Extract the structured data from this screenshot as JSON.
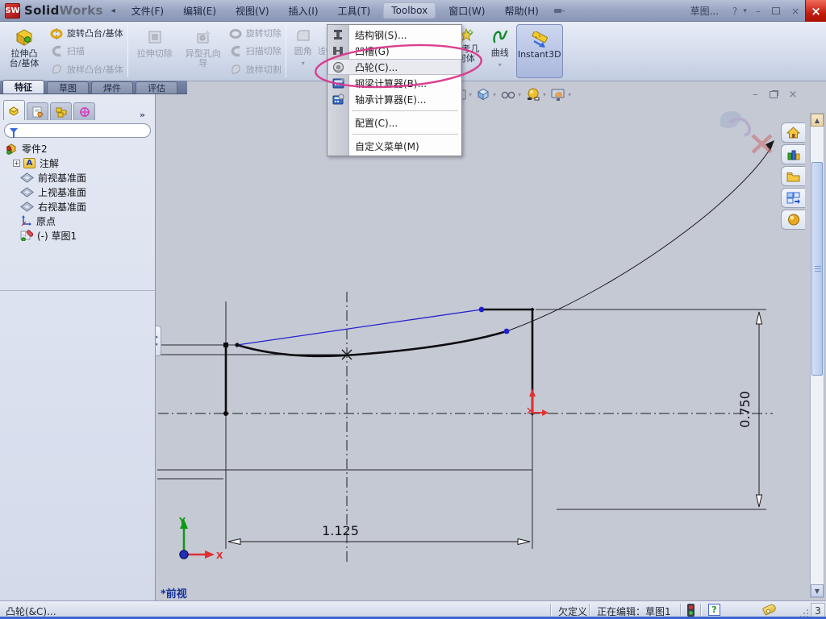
{
  "titlebar": {
    "logo_badge": "SW",
    "logo_solid": "Solid",
    "logo_works": "Works",
    "menus": {
      "file": "文件(F)",
      "edit": "编辑(E)",
      "view": "视图(V)",
      "insert": "插入(I)",
      "tools": "工具(T)",
      "toolbox": "Toolbox",
      "window": "窗口(W)",
      "help": "帮助(H)"
    },
    "search_label": "草图...",
    "help_glyph": "?",
    "win_min": "–",
    "win_close": "×"
  },
  "toolbar": {
    "extrude_boss": "拉伸凸台/基体",
    "revolve_boss": "旋转凸台/基体",
    "sweep": "扫描",
    "loft_boss": "放样凸台/基体",
    "extrude_cut": "拉伸切除",
    "hole_wizard": "异型孔向导",
    "revolve_cut": "旋转切除",
    "sweep_cut": "扫描切除",
    "loft_cut": "放样切割",
    "fillet": "圆角",
    "linear_pattern": "线性阵列",
    "reference_geometry": "参考几何体",
    "curves": "曲线",
    "instant3d": "Instant3D"
  },
  "menu": {
    "items": [
      {
        "label": "结构钢(S)..."
      },
      {
        "label": "凹槽(G)"
      },
      {
        "label": "凸轮(C)..."
      },
      {
        "label": "钢梁计算器(B)..."
      },
      {
        "label": "轴承计算器(E)..."
      },
      {
        "label": "配置(C)..."
      },
      {
        "label": "自定义菜单(M)"
      }
    ]
  },
  "cmd_tabs": {
    "t0": "特征",
    "t1": "草图",
    "t2": "焊件",
    "t3": "评估"
  },
  "tree": {
    "root": "零件2",
    "annotations": "注解",
    "front_plane": "前视基准面",
    "top_plane": "上视基准面",
    "right_plane": "右视基准面",
    "origin": "原点",
    "sketch1": "(-) 草图1"
  },
  "canvas": {
    "dim_width": "1.125",
    "dim_height": "0.750",
    "view_label": "*前视",
    "axis_x": "X",
    "axis_y": "Y"
  },
  "statusbar": {
    "message": "凸轮(&C)...",
    "definition": "欠定义",
    "editing": "正在编辑：草图1",
    "corner": "3"
  },
  "glyphs": {
    "dropdown_arrow": "▾",
    "chevron": "»",
    "up_arrow": "▲",
    "down_arrow": "▼",
    "flyout_arrow": "◂",
    "expand_plus": "+",
    "menu_collapse": "◂"
  },
  "colors": {
    "annotation_pink": "#d9368b",
    "origin_red": "#e03030",
    "sketch_blue": "#2020d0",
    "canvas_bg": "#c5c9d4"
  }
}
